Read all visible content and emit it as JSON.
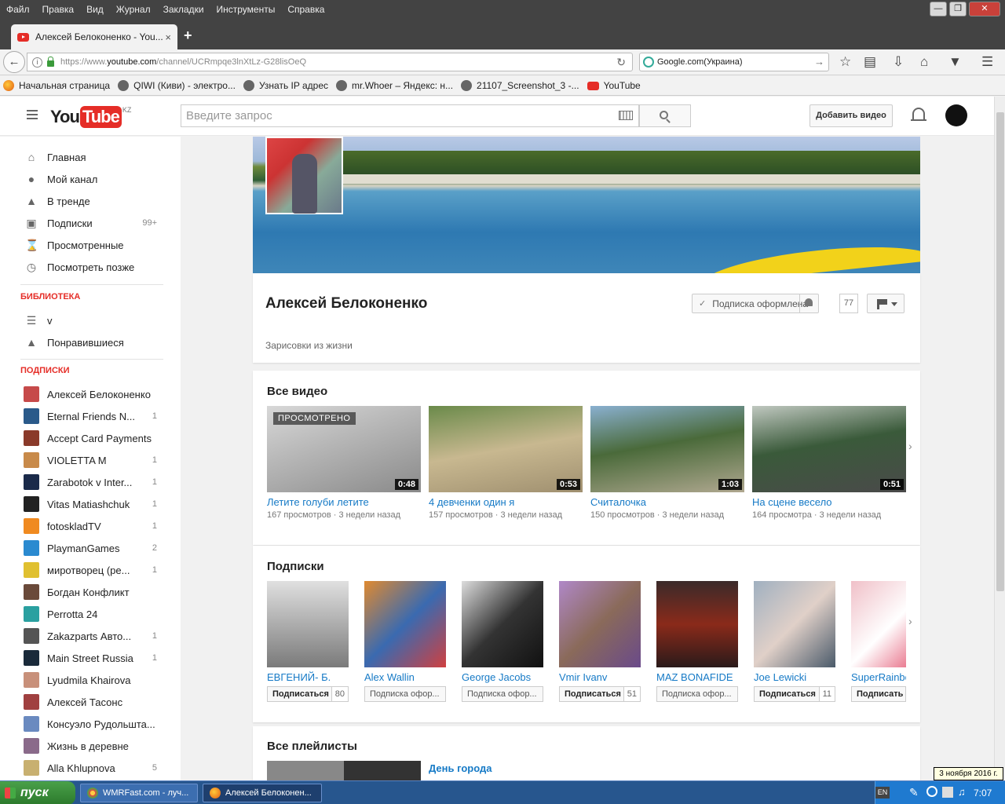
{
  "browser": {
    "menu": [
      "Файл",
      "Правка",
      "Вид",
      "Журнал",
      "Закладки",
      "Инструменты",
      "Справка"
    ],
    "tab_title": "Алексей Белоконенко - You...",
    "tab_close": "×",
    "new_tab": "+",
    "url_prefix": "https://www.",
    "url_domain": "youtube.com",
    "url_path": "/channel/UCRmpqe3lnXtLz-G28lisOeQ",
    "search_engine_text": "Google.com(Украина)",
    "bookmarks": [
      "Начальная страница",
      "QIWI (Киви) - электро...",
      "Узнать IP адрес",
      "mr.Whoer – Яндекс: н...",
      "21107_Screenshot_3 -...",
      "YouTube"
    ]
  },
  "youtube": {
    "logo_you": "You",
    "logo_tube": "Tube",
    "logo_region": "KZ",
    "search_placeholder": "Введите запрос",
    "add_video": "Добавить видео"
  },
  "sidebar": {
    "main": [
      {
        "label": "Главная",
        "icon": "home-icon"
      },
      {
        "label": "Мой канал",
        "icon": "user-icon"
      },
      {
        "label": "В тренде",
        "icon": "flame-icon"
      },
      {
        "label": "Подписки",
        "icon": "subscriptions-icon",
        "count": "99+"
      },
      {
        "label": "Просмотренные",
        "icon": "hourglass-icon"
      },
      {
        "label": "Посмотреть позже",
        "icon": "clock-icon"
      }
    ],
    "library_header": "БИБЛИОТЕКА",
    "library": [
      {
        "label": "v",
        "icon": "playlist-icon"
      },
      {
        "label": "Понравившиеся",
        "icon": "thumbs-up-icon"
      }
    ],
    "subs_header": "ПОДПИСКИ",
    "subscriptions": [
      {
        "label": "Алексей Белоконенко",
        "count": "",
        "color": "#c64a4a"
      },
      {
        "label": "Eternal Friends N...",
        "count": "1",
        "color": "#2a5a8a"
      },
      {
        "label": "Accept Card Payments",
        "count": "",
        "color": "#8a3a2a"
      },
      {
        "label": "VIOLETTA M",
        "count": "1",
        "color": "#c88a4a"
      },
      {
        "label": "Zarabotok v Inter...",
        "count": "1",
        "color": "#1a2a4a"
      },
      {
        "label": "Vitas Matiashchuk",
        "count": "1",
        "color": "#222222"
      },
      {
        "label": "fotoskladTV",
        "count": "1",
        "color": "#f08a20"
      },
      {
        "label": "PlaymanGames",
        "count": "2",
        "color": "#2a8ad0"
      },
      {
        "label": "миротворец (ре...",
        "count": "1",
        "color": "#e0c030"
      },
      {
        "label": "Богдан Конфликт",
        "count": "",
        "color": "#6a4a3a"
      },
      {
        "label": "Perrotta 24",
        "count": "",
        "color": "#2aa0a0"
      },
      {
        "label": "Zakazparts Авто...",
        "count": "1",
        "color": "#555555"
      },
      {
        "label": "Main Street Russia",
        "count": "1",
        "color": "#1a2a3a"
      },
      {
        "label": "Lyudmila Khairova",
        "count": "",
        "color": "#c8907a"
      },
      {
        "label": "Алексей Тасонс",
        "count": "",
        "color": "#a04040"
      },
      {
        "label": "Консуэло Рудольшта...",
        "count": "",
        "color": "#6a8ac0"
      },
      {
        "label": "Жизнь в деревне",
        "count": "",
        "color": "#8a6a8a"
      },
      {
        "label": "Alla Khlupnova",
        "count": "5",
        "color": "#c8b070"
      }
    ]
  },
  "channel": {
    "name": "Алексей Белоконенко",
    "subscribed_label": "Подписка оформлена",
    "subscriber_count": "77",
    "description": "Зарисовки из жизни"
  },
  "videos_section": {
    "title": "Все видео",
    "watched_badge": "ПРОСМОТРЕНО",
    "items": [
      {
        "title": "Летите голуби летите",
        "views": "167 просмотров",
        "age": "3 недели назад",
        "duration": "0:48",
        "watched": true,
        "bg": "linear-gradient(160deg,#d8d8d8 0%,#b8b8b8 40%,#8a8a8a 100%)"
      },
      {
        "title": "4 девченки один я",
        "views": "157 просмотров",
        "age": "3 недели назад",
        "duration": "0:53",
        "watched": false,
        "bg": "linear-gradient(170deg,#6a8a4a 0%,#c8b890 50%,#a09070 100%)"
      },
      {
        "title": "Считалочка",
        "views": "150 просмотров",
        "age": "3 недели назад",
        "duration": "1:03",
        "watched": false,
        "bg": "linear-gradient(170deg,#8ab0d0 0%,#4a6a3a 45%,#b0a890 100%)"
      },
      {
        "title": "На сцене весело",
        "views": "164 просмотра",
        "age": "3 недели назад",
        "duration": "0:51",
        "watched": false,
        "bg": "linear-gradient(170deg,#c0c8c0 0%,#3a5a3a 45%,#4a4a4a 100%)"
      }
    ]
  },
  "subs_section": {
    "title": "Подписки",
    "items": [
      {
        "name": "ЕВГЕНИЙ- Б.",
        "button": "Подписаться",
        "count": "80",
        "subscribed": false,
        "bg": "linear-gradient(180deg,#e0e0e0,#7a7a7a)"
      },
      {
        "name": "Alex Wallin",
        "button": "Подписка офор...",
        "count": "",
        "subscribed": true,
        "bg": "linear-gradient(135deg,#e08a30,#3a6ab0,#d04040)"
      },
      {
        "name": "George Jacobs",
        "button": "Подписка офор...",
        "count": "",
        "subscribed": true,
        "bg": "linear-gradient(135deg,#ddd,#333,#111)"
      },
      {
        "name": "Vmir Ivanv",
        "button": "Подписаться",
        "count": "51",
        "subscribed": false,
        "bg": "linear-gradient(135deg,#b088c8,#8a6a5a,#6a4a8a)"
      },
      {
        "name": "MAZ BONAFIDE",
        "button": "Подписка офор...",
        "count": "",
        "subscribed": true,
        "bg": "linear-gradient(180deg,#3a2a2a,#8a2a1a,#2a1a1a)"
      },
      {
        "name": "Joe Lewicki",
        "button": "Подписаться",
        "count": "11",
        "subscribed": false,
        "bg": "linear-gradient(135deg,#a0b0c0,#e0d0c8,#4a5a6a)"
      },
      {
        "name": "SuperRainbo’n",
        "button": "Подписать",
        "count": "",
        "subscribed": false,
        "bg": "linear-gradient(135deg,#f0c0c8,#fff,#e04060)"
      }
    ]
  },
  "playlists_section": {
    "title": "Все плейлисты",
    "first": "День города"
  },
  "taskbar": {
    "start": "пуск",
    "tasks": [
      "WMRFast.com - луч...",
      "Алексей Белоконен..."
    ],
    "lang": "EN",
    "time": "7:07",
    "date_tooltip": "3 ноября 2016 г."
  }
}
